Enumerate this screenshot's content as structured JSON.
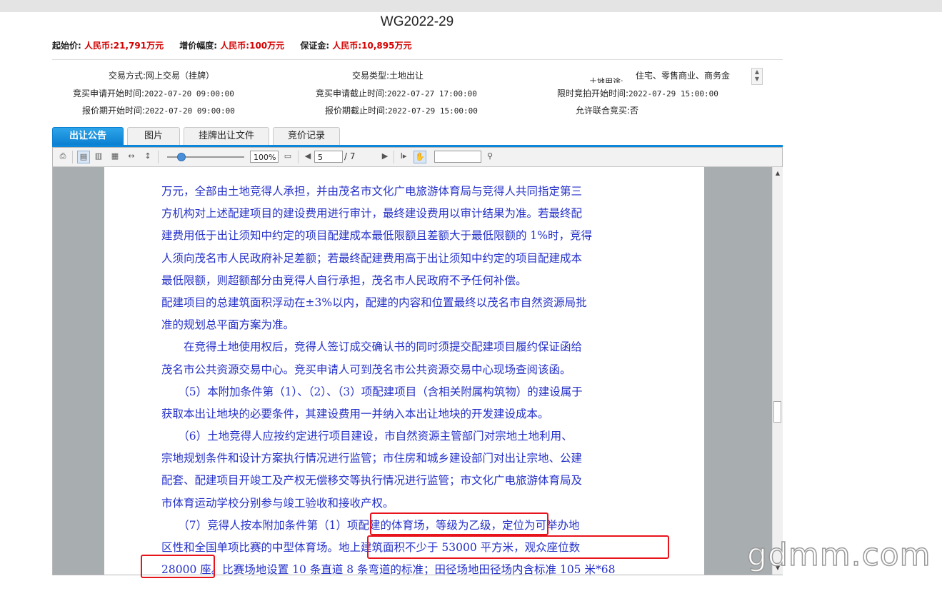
{
  "header": {
    "title": "WG2022-29",
    "start_price_label": "起始价:",
    "start_price": "人民币:21,791万元",
    "increment_label": "增价幅度:",
    "increment": "人民币:100万元",
    "deposit_label": "保证金:",
    "deposit": "人民币:10,895万元"
  },
  "info": {
    "trade_mode_label": "交易方式:",
    "trade_mode": "网上交易（挂牌）",
    "trade_type_label": "交易类型:",
    "trade_type": "土地出让",
    "land_use_label": "土地用途:",
    "land_use": "住宅、零售商业、商务金",
    "apply_start_label": "竞买申请开始时间:",
    "apply_start": "2022-07-20 09:00:00",
    "apply_end_label": "竞买申请截止时间:",
    "apply_end": "2022-07-27 17:00:00",
    "auction_start_label": "限时竞拍开始时间:",
    "auction_start": "2022-07-29 15:00:00",
    "quote_start_label": "报价期开始时间:",
    "quote_start": "2022-07-20 09:00:00",
    "quote_end_label": "报价期截止时间:",
    "quote_end": "2022-07-29 15:00:00",
    "joint_bid_label": "允许联合竞买:",
    "joint_bid": "否"
  },
  "tabs": [
    {
      "label": "出让公告",
      "active": true
    },
    {
      "label": "图片"
    },
    {
      "label": "挂牌出让文件"
    },
    {
      "label": "竞价记录"
    }
  ],
  "viewer": {
    "zoom": "100%",
    "page_current": "5",
    "page_total": "/ 7",
    "find_value": "",
    "lines": [
      "万元，全部由土地竞得人承担，并由茂名市文化广电旅游体育局与竞得人共同指定第三",
      "方机构对上述配建项目的建设费用进行审计，最终建设费用以审计结果为准。若最终配",
      "建费用低于出让须知中约定的项目配建成本最低限额且差额大于最低限额的 1%时，竞得",
      "人须向茂名市人民政府补足差额；若最终配建费用高于出让须知中约定的项目配建成本",
      "最低限额，则超额部分由竞得人自行承担，茂名市人民政府不予任何补偿。",
      "配建项目的总建筑面积浮动在±3%以内，配建的内容和位置最终以茂名市自然资源局批",
      "准的规划总平面方案为准。",
      "　　在竞得土地使用权后，竞得人签订成交确认书的同时须提交配建项目履约保证函给",
      "茂名市公共资源交易中心。竞买申请人可到茂名市公共资源交易中心现场查阅该函。",
      "　　（5）本附加条件第（1）、（2）、（3）项配建项目（含相关附属构筑物）的建设属于",
      "获取本出让地块的必要条件，其建设费用一并纳入本出让地块的开发建设成本。",
      "　　（6）土地竞得人应按约定进行项目建设，市自然资源主管部门对宗地土地利用、",
      "宗地规划条件和设计方案执行情况进行监管；市住房和城乡建设部门对出让宗地、公建",
      "配套、配建项目开竣工及产权无偿移交等执行情况进行监管；市文化广电旅游体育局及",
      "市体育运动学校分别参与竣工验收和接收产权。",
      "　　（7）竞得人按本附加条件第（1）项配建的体育场，等级为乙级，定位为可举办地",
      "区性和全国单项比赛的中型体育场。地上建筑面积不少于 53000 平方米，观众座位数",
      "28000 座。比赛场地设置 10 条直道 8 条弯道的标准；田径场地田径场内含标准 105 米*68"
    ]
  },
  "watermark": "gdmm.com",
  "colors": {
    "price_red": "#d40000",
    "doc_text_blue": "#2430c8",
    "tab_active_blue": "#0b86d8",
    "highlight_red": "#e8141c"
  }
}
